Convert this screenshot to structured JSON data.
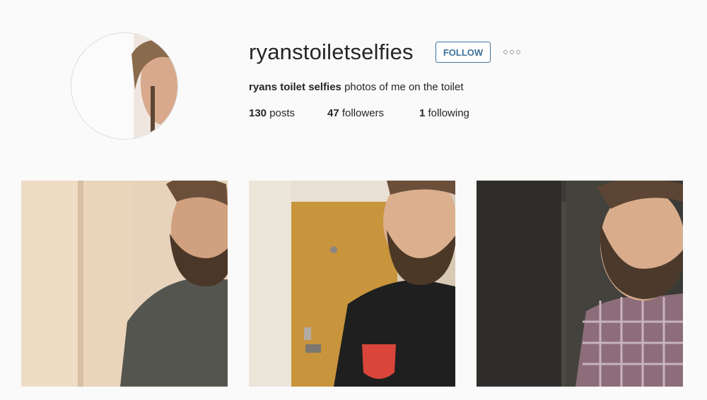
{
  "profile": {
    "username": "ryanstoiletselfies",
    "follow_label": "FOLLOW",
    "full_name": "ryans toilet selfies",
    "bio_text": "photos of me on the toilet",
    "stats": {
      "posts_count": "130",
      "posts_label": "posts",
      "followers_count": "47",
      "followers_label": "followers",
      "following_count": "1",
      "following_label": "following"
    }
  },
  "icons": {
    "more_options": "more-options-icon"
  },
  "colors": {
    "follow_accent": "#3f729b",
    "background": "#fafafa"
  }
}
